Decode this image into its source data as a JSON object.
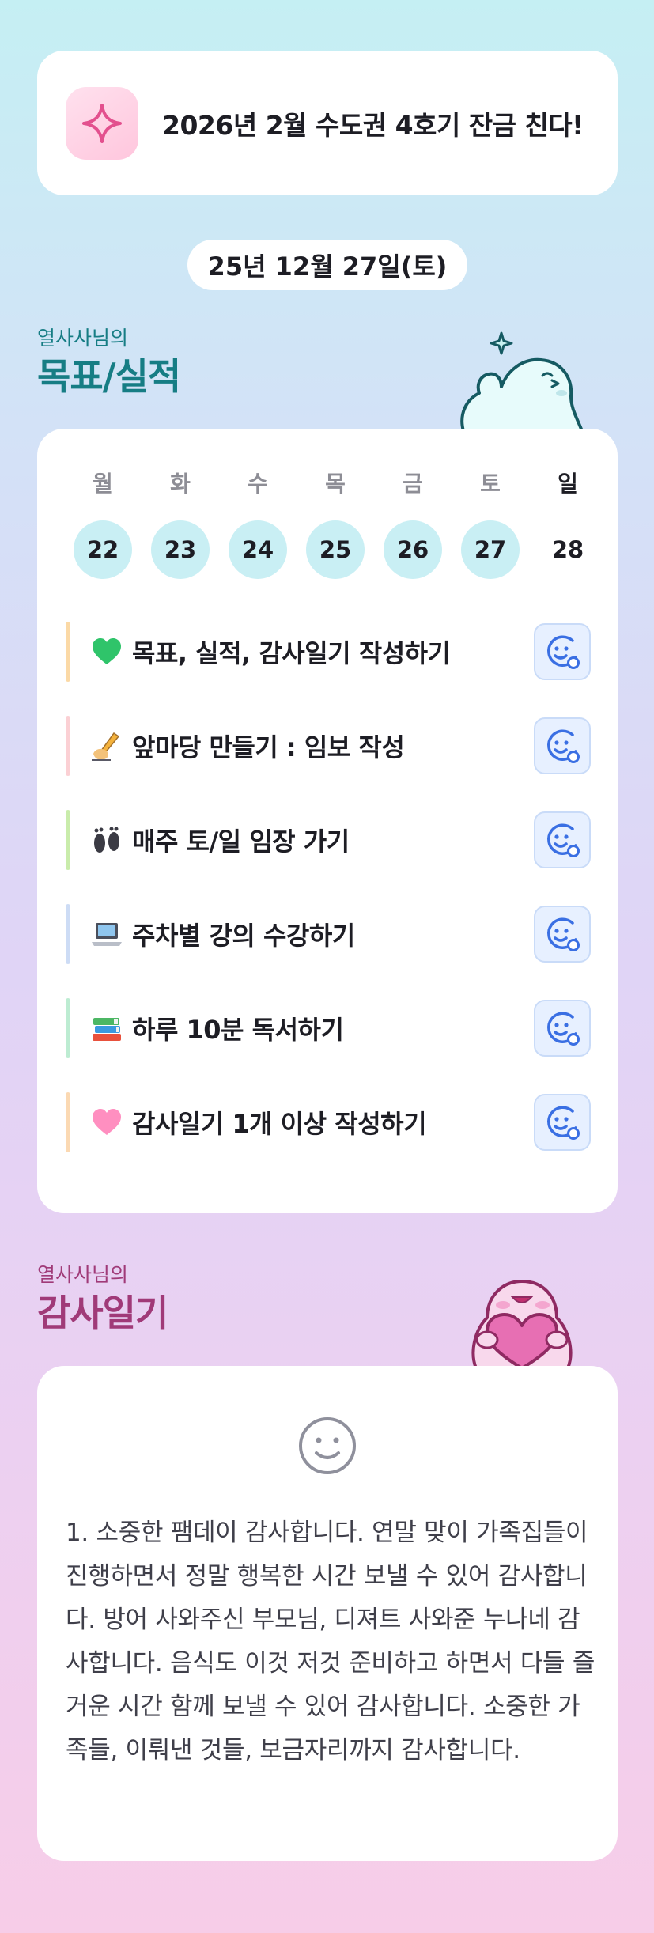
{
  "goal_banner": {
    "text": "2026년 2월 수도권 4호기 잔금 친다!",
    "icon": "sparkle-icon"
  },
  "date_pill": "25년 12월 27일(토)",
  "goals_section": {
    "subtitle": "열사사님의",
    "title": "목표/실적"
  },
  "week": {
    "days": [
      {
        "name": "월",
        "num": "22",
        "marked": true
      },
      {
        "name": "화",
        "num": "23",
        "marked": true
      },
      {
        "name": "수",
        "num": "24",
        "marked": true
      },
      {
        "name": "목",
        "num": "25",
        "marked": true
      },
      {
        "name": "금",
        "num": "26",
        "marked": true
      },
      {
        "name": "토",
        "num": "27",
        "marked": true
      },
      {
        "name": "일",
        "num": "28",
        "marked": false
      }
    ]
  },
  "tasks": [
    {
      "emoji": "green-heart",
      "label": "목표, 실적, 감사일기 작성하기",
      "bar_color": "#fbd9a6"
    },
    {
      "emoji": "writing-hand",
      "label": "앞마당 만들기 : 임보 작성",
      "bar_color": "#fbd0d4"
    },
    {
      "emoji": "footprints",
      "label": "매주 토/일 임장 가기",
      "bar_color": "#c9ecab"
    },
    {
      "emoji": "laptop",
      "label": "주차별 강의 수강하기",
      "bar_color": "#cddcf5"
    },
    {
      "emoji": "books",
      "label": "하루 10분 독서하기",
      "bar_color": "#bdecd2"
    },
    {
      "emoji": "pink-heart",
      "label": "감사일기 1개 이상 작성하기",
      "bar_color": "#fbd9b3"
    }
  ],
  "gratitude_section": {
    "subtitle": "열사사님의",
    "title": "감사일기"
  },
  "gratitude_text": "1. 소중한 팸데이 감사합니다. 연말 맞이 가족집들이 진행하면서 정말 행복한 시간 보낼 수 있어 감사합니다. 방어 사와주신 부모님, 디져트 사와준 누나네 감사합니다. 음식도 이것 저것 준비하고 하면서 다들 즐거운 시간 함께 보낼 수 있어 감사합니다. 소중한 가족들, 이뤄낸 것들, 보금자리까지 감사합니다.",
  "colors": {
    "teal_title": "#167d84",
    "plum_title": "#a03a78",
    "day_circle": "#c9eff4",
    "action_button": "#e7f0ff"
  }
}
